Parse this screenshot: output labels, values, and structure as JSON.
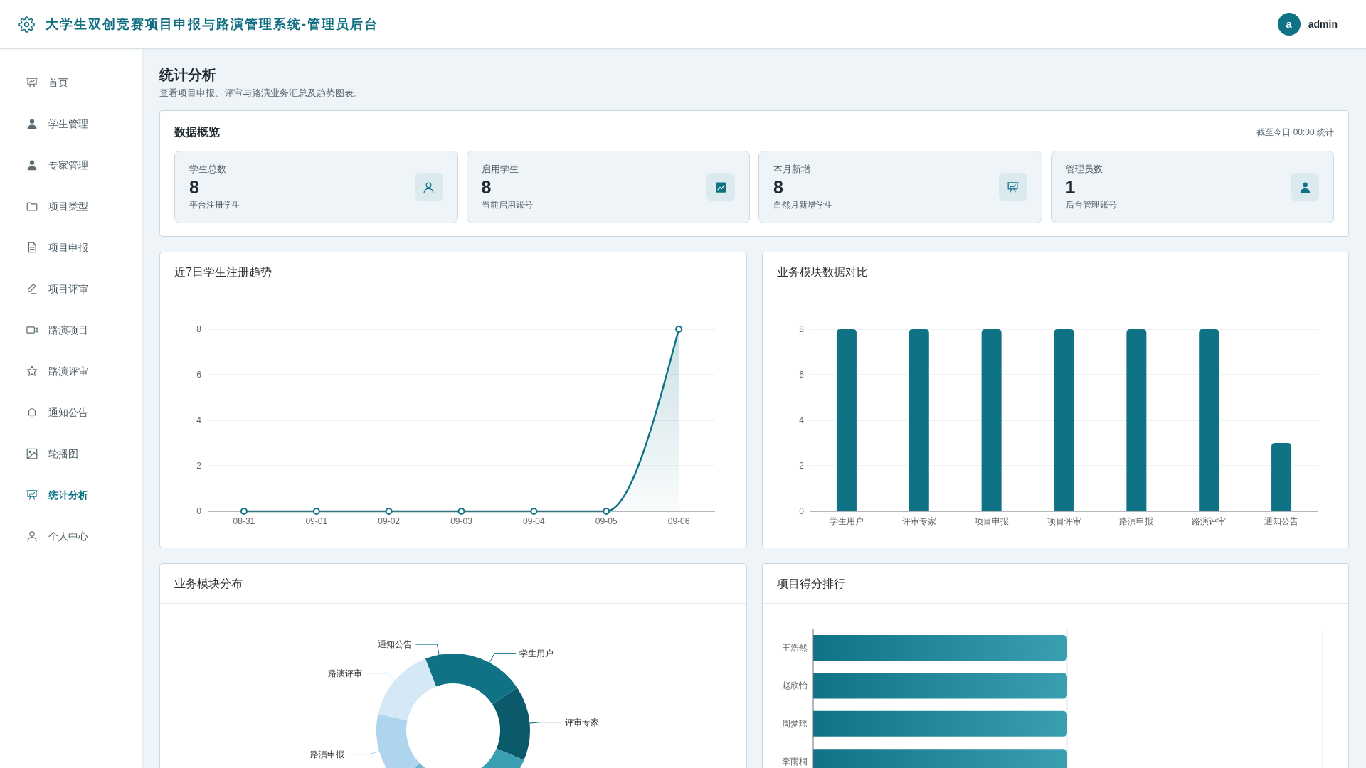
{
  "header": {
    "title": "大学生双创竞赛项目申报与路演管理系统-管理员后台",
    "avatar": "a",
    "username": "admin"
  },
  "sidebar": {
    "items": [
      {
        "label": "首页",
        "selected": false
      },
      {
        "label": "学生管理",
        "selected": false
      },
      {
        "label": "专家管理",
        "selected": false
      },
      {
        "label": "项目类型",
        "selected": false
      },
      {
        "label": "项目申报",
        "selected": false
      },
      {
        "label": "项目评审",
        "selected": false
      },
      {
        "label": "路演项目",
        "selected": false
      },
      {
        "label": "路演评审",
        "selected": false
      },
      {
        "label": "通知公告",
        "selected": false
      },
      {
        "label": "轮播图",
        "selected": false
      },
      {
        "label": "统计分析",
        "selected": true
      },
      {
        "label": "个人中心",
        "selected": false
      }
    ]
  },
  "page": {
    "title": "统计分析",
    "subtitle": "查看项目申报、评审与路演业务汇总及趋势图表。"
  },
  "overview": {
    "title": "数据概览",
    "note": "截至今日 00:00 统计",
    "cards": [
      {
        "label": "学生总数",
        "value": "8",
        "caption": "平台注册学生"
      },
      {
        "label": "启用学生",
        "value": "8",
        "caption": "当前启用账号"
      },
      {
        "label": "本月新增",
        "value": "8",
        "caption": "自然月新增学生"
      },
      {
        "label": "管理员数",
        "value": "1",
        "caption": "后台管理账号"
      }
    ]
  },
  "trend_chart": {
    "title": "近7日学生注册趋势",
    "chart_data": {
      "type": "area",
      "categories": [
        "08-31",
        "09-01",
        "09-02",
        "09-03",
        "09-04",
        "09-05",
        "09-06"
      ],
      "values": [
        0,
        0,
        0,
        0,
        0,
        0,
        8
      ],
      "ylim": [
        0,
        8
      ],
      "yticks": [
        0,
        2,
        4,
        6,
        8
      ],
      "grid": true
    }
  },
  "module_chart": {
    "title": "业务模块数据对比",
    "chart_data": {
      "type": "bar",
      "categories": [
        "学生用户",
        "评审专家",
        "项目申报",
        "项目评审",
        "路演申报",
        "路演评审",
        "通知公告"
      ],
      "values": [
        8,
        8,
        8,
        8,
        8,
        8,
        3
      ],
      "ylim": [
        0,
        8
      ],
      "yticks": [
        0,
        2,
        4,
        6,
        8
      ],
      "grid": true
    }
  },
  "distribution_chart": {
    "title": "业务模块分布",
    "slices": [
      {
        "label": "学生用户",
        "color": "#0f7385"
      },
      {
        "label": "评审专家",
        "color": "#0b5a6b"
      },
      {
        "color": "#3a9fb1"
      },
      {
        "color": "#6fb7d3"
      },
      {
        "label": "路演申报",
        "color": "#aed4ee"
      },
      {
        "label": "路演评审",
        "color": "#d5e8f5"
      },
      {
        "label": "通知公告",
        "color": "#0f7385"
      }
    ]
  },
  "ranking_chart": {
    "title": "项目得分排行",
    "rows": [
      {
        "name": "王浩然"
      },
      {
        "name": "赵欣怡"
      },
      {
        "name": "周梦瑶"
      },
      {
        "name": "李雨桐"
      }
    ]
  }
}
